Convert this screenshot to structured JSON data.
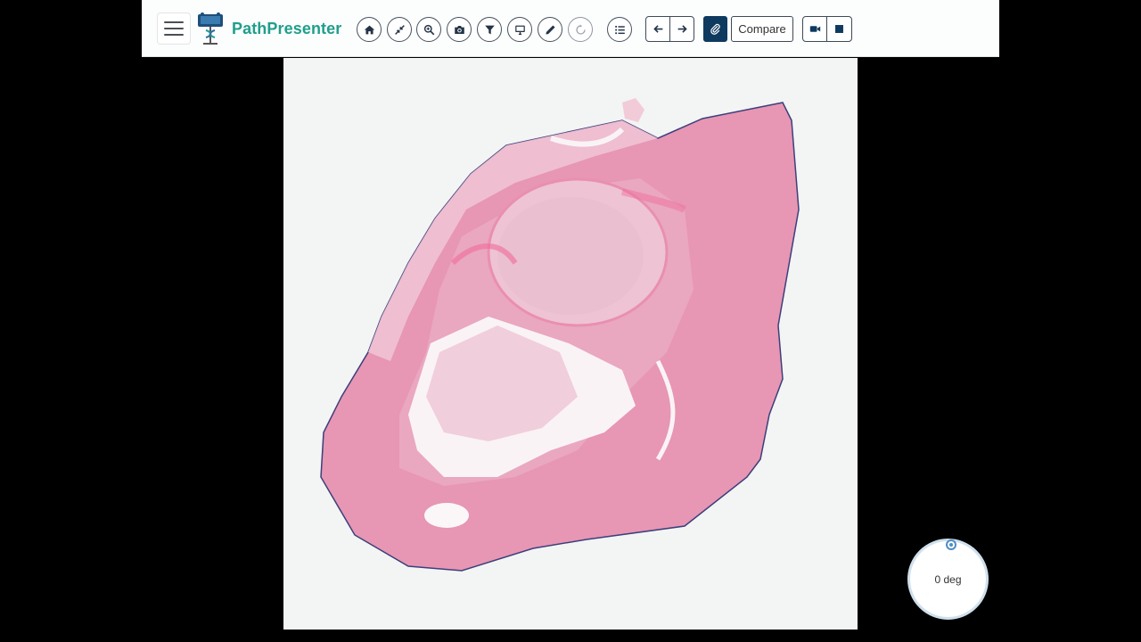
{
  "app": {
    "brand_name": "PathPresenter",
    "accent_color": "#1f9f8c"
  },
  "toolbar": {
    "menu_icon": "hamburger-menu-icon",
    "tools": [
      {
        "name": "home",
        "icon": "home-icon"
      },
      {
        "name": "fit-to-screen",
        "icon": "collapse-arrows-icon"
      },
      {
        "name": "zoom",
        "icon": "zoom-in-icon"
      },
      {
        "name": "snapshot",
        "icon": "camera-icon"
      },
      {
        "name": "filter",
        "icon": "filter-icon"
      },
      {
        "name": "present",
        "icon": "monitor-icon"
      },
      {
        "name": "annotate",
        "icon": "pencil-icon"
      },
      {
        "name": "rotate",
        "icon": "circular-arrow-icon"
      },
      {
        "name": "list",
        "icon": "list-icon"
      }
    ],
    "nav": {
      "prev_icon": "arrow-left-icon",
      "next_icon": "arrow-right-icon"
    },
    "attach_icon": "paperclip-icon",
    "compare_label": "Compare",
    "record_icon": "video-camera-icon",
    "stop_icon": "stop-square-icon",
    "primary_dark": "#0e3a5f"
  },
  "viewer": {
    "slide_stain_color": "#e79bb8",
    "background_color": "#f3f4f4"
  },
  "rotation": {
    "label": "0 deg"
  }
}
